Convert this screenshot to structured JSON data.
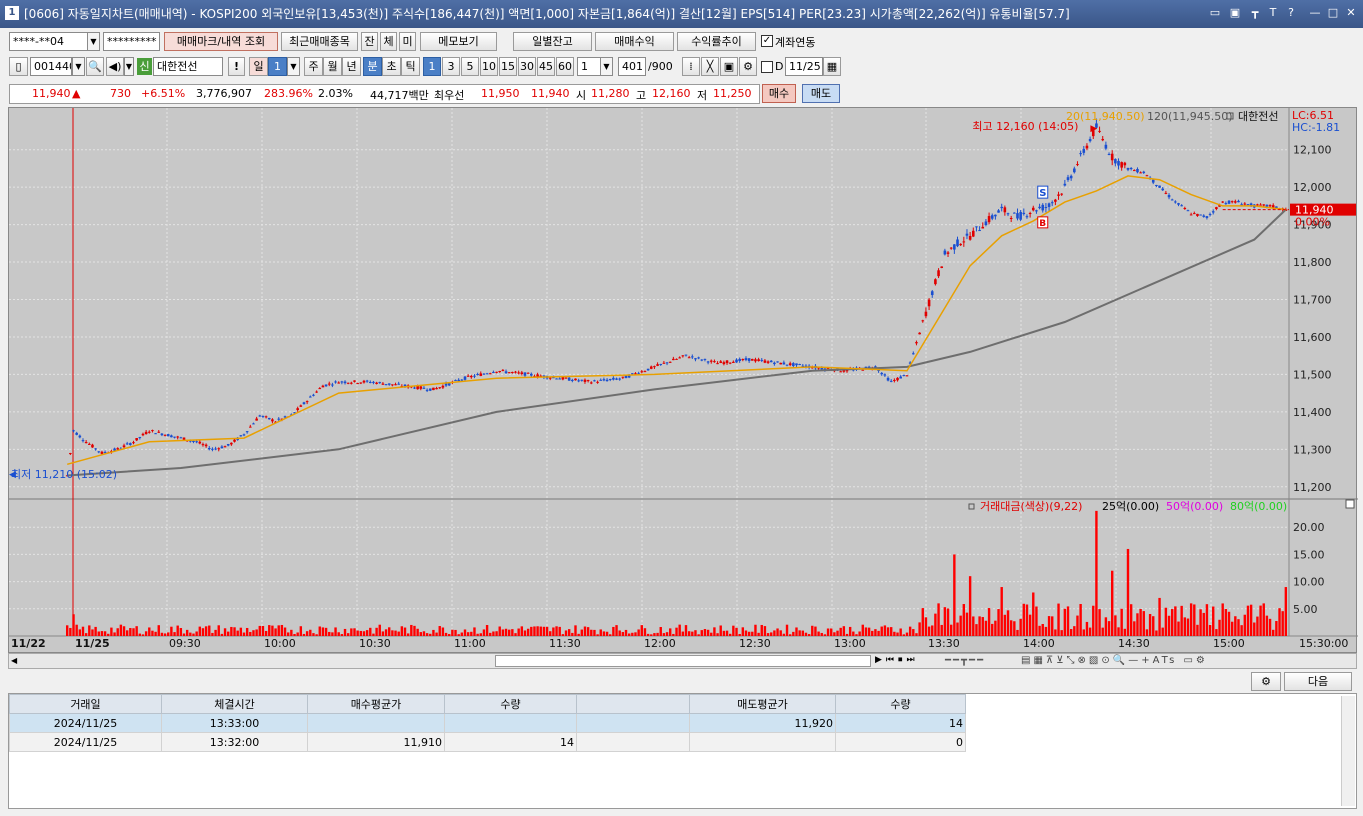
{
  "window": {
    "number": "1",
    "title": "[0606] 자동일지차트(매매내역) - KOSPI200 외국인보유[13,453(천)] 주식수[186,447(천)] 액면[1,000] 자본금[1,864(억)] 결산[12월] EPS[514] PER[23.23] 시가총액[22,262(억)] 유통비율[57.7]",
    "buttons": [
      "▭",
      "▣",
      "┳",
      "T",
      "?",
      "—",
      "□",
      "✕"
    ]
  },
  "row1": {
    "account": "****-**04",
    "password": "*********",
    "btn_mark": "매매마크/내역 조회",
    "btn_recent": "최근매매종목",
    "btn_jan": "잔",
    "btn_che": "체",
    "btn_mi": "미",
    "btn_memo": "메모보기",
    "btn_daily": "일별잔고",
    "btn_profit": "매매수익",
    "btn_rate": "수익률추이",
    "chk_account_label": "계좌연동",
    "chk_account": true
  },
  "row2": {
    "code": "001440",
    "sin": "신",
    "stock_name": "대한전선",
    "excl": "!",
    "periods": [
      "일",
      "1",
      "주",
      "월",
      "년",
      "분",
      "초",
      "틱"
    ],
    "selected_period": "분",
    "minutes": [
      "1",
      "3",
      "5",
      "10",
      "15",
      "30",
      "45",
      "60"
    ],
    "selected_minute": "1",
    "count_sel": "1",
    "bars": "401",
    "bars_total": "/900",
    "d_label": "D",
    "date": "11/25"
  },
  "quote": {
    "price": "11,940",
    "arrow": "▲",
    "change": "730",
    "change_pct": "+6.51%",
    "volume": "3,776,907",
    "vol_ratio": "283.96%",
    "turnover": "2.03%",
    "amount": "44,717백만",
    "best_label": "최우선",
    "best_ask": "11,950",
    "best_bid": "11,940",
    "open_label": "시",
    "open": "11,280",
    "high_label": "고",
    "high": "12,160",
    "low_label": "저",
    "low": "11,250",
    "buy_btn": "매수",
    "sell_btn": "매도"
  },
  "chart_data": {
    "type": "candlestick",
    "stock": "대한전선",
    "legend_ma20": "20(11,940.50)",
    "legend_ma120": "120(11,945.50)",
    "legend_name": "대한전선",
    "lc": "LC:6.51",
    "hc": "HC:-1.81",
    "high_annotation": "최고 12,160 (14:05)",
    "low_annotation": "최저 11,210 (15:02)",
    "current_price_label": "11,940",
    "current_pct_label": "0.00%",
    "y_ticks": [
      "12,100",
      "12,000",
      "11,900",
      "11,800",
      "11,700",
      "11,600",
      "11,500",
      "11,400",
      "11,300",
      "11,200"
    ],
    "y_values": [
      12100,
      12000,
      11900,
      11800,
      11700,
      11600,
      11500,
      11400,
      11300,
      11200
    ],
    "ylim": [
      11170,
      12190
    ],
    "x_labels": [
      "11/22",
      "11/25",
      "09:30",
      "10:00",
      "10:30",
      "11:00",
      "11:30",
      "12:00",
      "12:30",
      "13:00",
      "13:30",
      "14:00",
      "14:30",
      "15:00",
      "15:30:00"
    ],
    "price_path": [
      [
        0,
        11210
      ],
      [
        3,
        11210
      ],
      [
        6,
        11230
      ],
      [
        9,
        11215
      ],
      [
        12,
        11220
      ],
      [
        14,
        11230
      ],
      [
        16,
        11350
      ],
      [
        20,
        11320
      ],
      [
        25,
        11290
      ],
      [
        30,
        11300
      ],
      [
        35,
        11320
      ],
      [
        40,
        11350
      ],
      [
        45,
        11340
      ],
      [
        50,
        11330
      ],
      [
        55,
        11320
      ],
      [
        60,
        11300
      ],
      [
        65,
        11310
      ],
      [
        70,
        11340
      ],
      [
        75,
        11390
      ],
      [
        80,
        11375
      ],
      [
        85,
        11390
      ],
      [
        90,
        11430
      ],
      [
        95,
        11470
      ],
      [
        100,
        11480
      ],
      [
        110,
        11480
      ],
      [
        120,
        11470
      ],
      [
        130,
        11460
      ],
      [
        140,
        11490
      ],
      [
        150,
        11510
      ],
      [
        160,
        11500
      ],
      [
        170,
        11490
      ],
      [
        180,
        11480
      ],
      [
        190,
        11490
      ],
      [
        200,
        11520
      ],
      [
        210,
        11550
      ],
      [
        220,
        11530
      ],
      [
        230,
        11540
      ],
      [
        240,
        11530
      ],
      [
        250,
        11520
      ],
      [
        260,
        11510
      ],
      [
        270,
        11520
      ],
      [
        275,
        11480
      ],
      [
        280,
        11500
      ],
      [
        284,
        11610
      ],
      [
        288,
        11720
      ],
      [
        292,
        11820
      ],
      [
        296,
        11850
      ],
      [
        300,
        11870
      ],
      [
        304,
        11900
      ],
      [
        310,
        11940
      ],
      [
        315,
        11920
      ],
      [
        320,
        11940
      ],
      [
        325,
        11950
      ],
      [
        330,
        12000
      ],
      [
        335,
        12080
      ],
      [
        340,
        12160
      ],
      [
        345,
        12080
      ],
      [
        350,
        12050
      ],
      [
        355,
        12040
      ],
      [
        360,
        12000
      ],
      [
        365,
        11960
      ],
      [
        370,
        11930
      ],
      [
        375,
        11920
      ],
      [
        380,
        11960
      ],
      [
        385,
        11960
      ],
      [
        390,
        11950
      ],
      [
        395,
        11950
      ],
      [
        400,
        11940
      ]
    ],
    "ma20_path": [
      [
        14,
        11260
      ],
      [
        40,
        11320
      ],
      [
        70,
        11330
      ],
      [
        100,
        11450
      ],
      [
        150,
        11490
      ],
      [
        200,
        11500
      ],
      [
        250,
        11520
      ],
      [
        280,
        11510
      ],
      [
        290,
        11650
      ],
      [
        300,
        11790
      ],
      [
        310,
        11870
      ],
      [
        320,
        11910
      ],
      [
        330,
        11960
      ],
      [
        340,
        11990
      ],
      [
        350,
        12030
      ],
      [
        360,
        12020
      ],
      [
        370,
        11980
      ],
      [
        380,
        11950
      ],
      [
        390,
        11950
      ],
      [
        400,
        11940
      ]
    ],
    "ma120_path": [
      [
        14,
        11230
      ],
      [
        50,
        11250
      ],
      [
        100,
        11300
      ],
      [
        150,
        11400
      ],
      [
        200,
        11460
      ],
      [
        250,
        11510
      ],
      [
        280,
        11520
      ],
      [
        300,
        11560
      ],
      [
        330,
        11640
      ],
      [
        360,
        11750
      ],
      [
        390,
        11860
      ],
      [
        400,
        11940
      ]
    ],
    "buy_mark": "B",
    "sell_mark": "S",
    "volume_legend": "거래대금(색상)(9,22)",
    "volume_legend_25": "25억(0.00)",
    "volume_legend_50": "50억(0.00)",
    "volume_legend_80": "80억(0.00)",
    "volume_ticks": [
      "20.00",
      "15.00",
      "10.00",
      "5.00"
    ],
    "volume_spikes": [
      [
        290,
        6
      ],
      [
        295,
        15
      ],
      [
        300,
        11
      ],
      [
        310,
        9
      ],
      [
        320,
        8
      ],
      [
        330,
        5
      ],
      [
        340,
        23
      ],
      [
        345,
        12
      ],
      [
        350,
        16
      ],
      [
        360,
        7
      ],
      [
        370,
        6
      ],
      [
        400,
        9
      ]
    ],
    "colors": {
      "up": "#e00000",
      "down": "#1a4fd0",
      "ma20": "#e8a000",
      "ma120": "#6e6e6e",
      "volume": "#ff0000"
    }
  },
  "scrollbar": {
    "next_btn": "다음"
  },
  "trades": {
    "headers": [
      "거래일",
      "체결시간",
      "매수평균가",
      "수량",
      "",
      "매도평균가",
      "수량"
    ],
    "rows": [
      [
        "2024/11/25",
        "13:33:00",
        "",
        "",
        "",
        "11,920",
        "14"
      ],
      [
        "2024/11/25",
        "13:32:00",
        "11,910",
        "14",
        "",
        "",
        "0"
      ]
    ]
  }
}
